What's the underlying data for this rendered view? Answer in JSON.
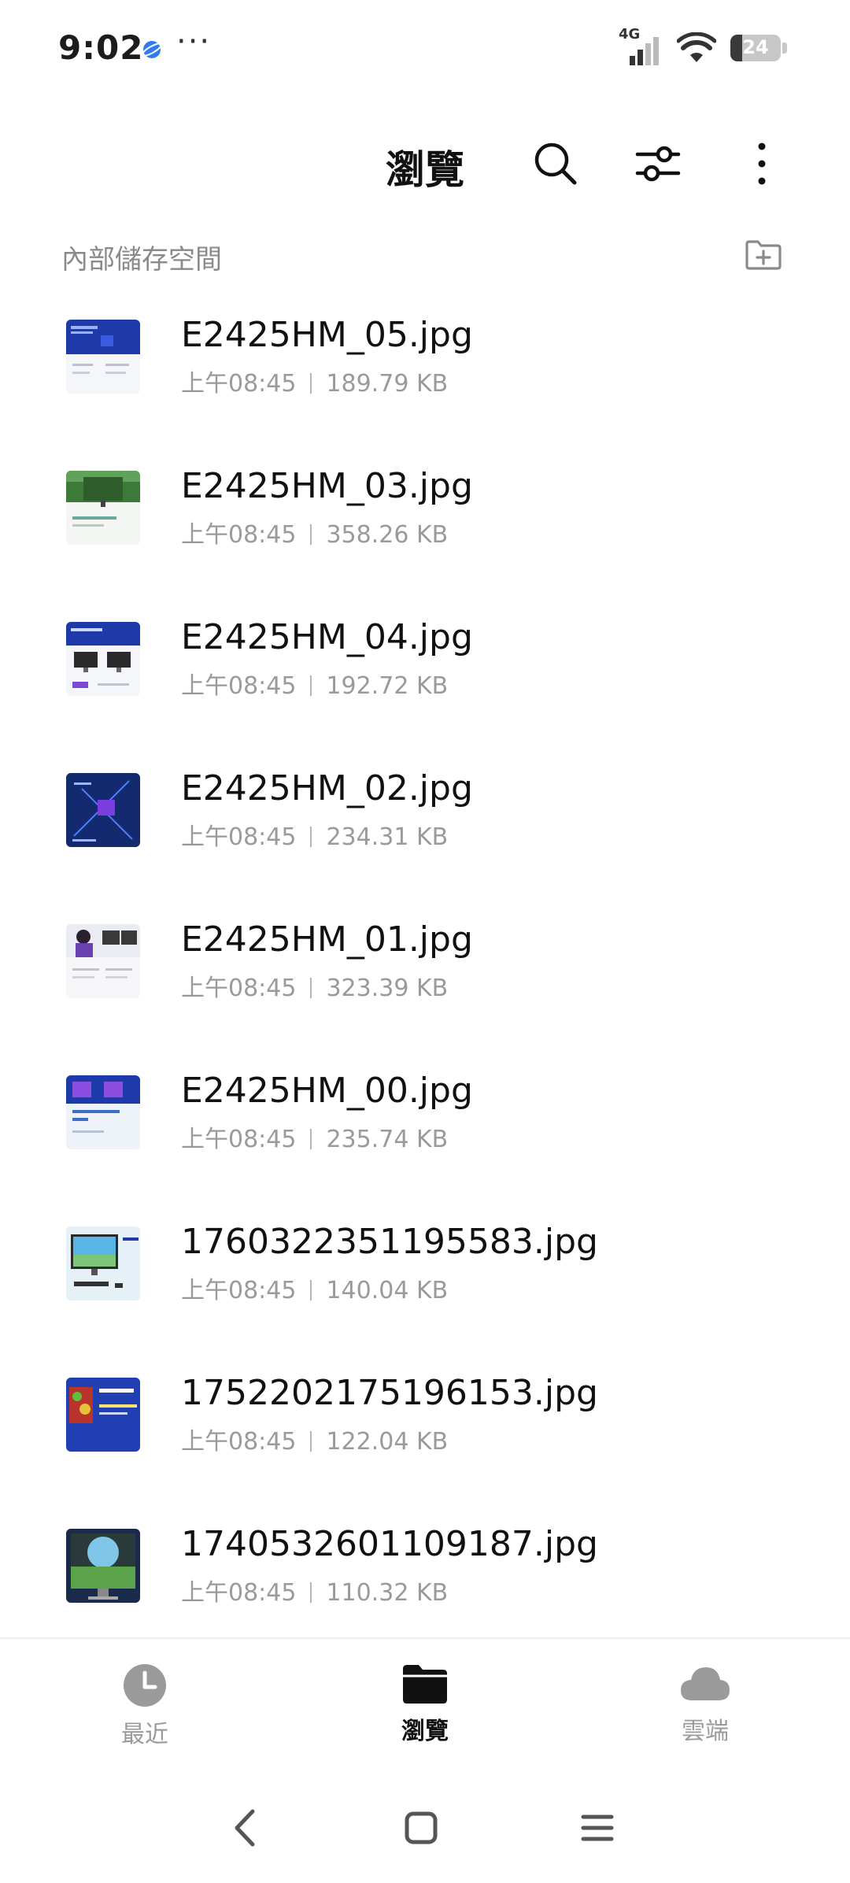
{
  "status_bar": {
    "time": "9:02",
    "overflow": "···",
    "network": "4G",
    "battery": "24",
    "battery_level": 0.24
  },
  "app_bar": {
    "title": "瀏覽",
    "icons": [
      "search-icon",
      "filter-sliders-icon",
      "more-vert-icon"
    ]
  },
  "section": {
    "title": "內部儲存空間",
    "action_icon": "new-folder-icon"
  },
  "files": [
    {
      "name": "E2425HM_05.jpg",
      "time": "上午08:45",
      "size": "189.79 KB"
    },
    {
      "name": "E2425HM_03.jpg",
      "time": "上午08:45",
      "size": "358.26 KB"
    },
    {
      "name": "E2425HM_04.jpg",
      "time": "上午08:45",
      "size": "192.72 KB"
    },
    {
      "name": "E2425HM_02.jpg",
      "time": "上午08:45",
      "size": "234.31 KB"
    },
    {
      "name": "E2425HM_01.jpg",
      "time": "上午08:45",
      "size": "323.39 KB"
    },
    {
      "name": "E2425HM_00.jpg",
      "time": "上午08:45",
      "size": "235.74 KB"
    },
    {
      "name": "1760322351195583.jpg",
      "time": "上午08:45",
      "size": "140.04 KB"
    },
    {
      "name": "1752202175196153.jpg",
      "time": "上午08:45",
      "size": "122.04 KB"
    },
    {
      "name": "1740532601109187.jpg",
      "time": "上午08:45",
      "size": "110.32 KB"
    }
  ],
  "bottom_nav": {
    "recent": "最近",
    "browse": "瀏覽",
    "cloud": "雲端",
    "active": "browse"
  },
  "colors": {
    "accent": "#111111",
    "muted": "#9a9a9a",
    "thumb_blue": "#1e3aa8"
  }
}
